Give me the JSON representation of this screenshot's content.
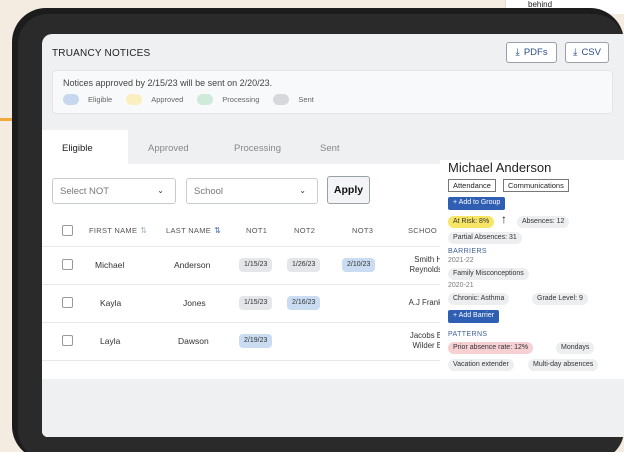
{
  "page": {
    "title": "TRUANCY NOTICES",
    "pdf_label": "PDFs",
    "csv_label": "CSV",
    "bg_peek_text": "behind"
  },
  "notice": {
    "text": "Notices approved by 2/15/23 will be sent on 2/20/23.",
    "legend": [
      {
        "label": "Eligible",
        "color": "#c7d8ee"
      },
      {
        "label": "Approved",
        "color": "#fbeec0"
      },
      {
        "label": "Processing",
        "color": "#cfe9da"
      },
      {
        "label": "Sent",
        "color": "#d6d8db"
      }
    ]
  },
  "tabs": [
    {
      "label": "Eligible",
      "active": true
    },
    {
      "label": "Approved",
      "active": false
    },
    {
      "label": "Processing",
      "active": false
    },
    {
      "label": "Sent",
      "active": false
    }
  ],
  "filters": {
    "not_placeholder": "Select NOT",
    "school_placeholder": "School",
    "apply_label": "Apply"
  },
  "table": {
    "headers": {
      "first_name": "FIRST NAME",
      "last_name": "LAST NAME",
      "not1": "NOT1",
      "not2": "NOT2",
      "not3": "NOT3",
      "school": "SCHOO"
    },
    "rows": [
      {
        "first": "Michael",
        "last": "Anderson",
        "not1": "1/15/23",
        "not2": "1/26/23",
        "not3": "2/10/23",
        "school1": "Smith H",
        "school2": "Reynolds"
      },
      {
        "first": "Kayla",
        "last": "Jones",
        "not1": "1/15/23",
        "not2": "2/16/23",
        "not3": "",
        "school1": "A.J Frank",
        "school2": ""
      },
      {
        "first": "Layla",
        "last": "Dawson",
        "not1": "2/19/23",
        "not2": "",
        "not3": "",
        "school1": "Jacobs E",
        "school2": "Wilder E"
      }
    ]
  },
  "panel": {
    "name": "Michael Anderson",
    "tab_attendance": "Attendance",
    "tab_communications": "Communications",
    "add_group": "+ Add to Group",
    "risk": "At Risk: 8%",
    "absences": "Absences: 12",
    "partial": "Partial Absences: 31",
    "barriers_heading": "BARRIERS",
    "year1": "2021-22",
    "barrier1": "Family Misconceptions",
    "year2": "2020-21",
    "barrier2": "Chronic: Asthma",
    "grade": "Grade Level: 9",
    "add_barrier": "+ Add Barrier",
    "patterns_heading": "PATTERNS",
    "pattern1": "Prior absence rate: 12%",
    "pattern2": "Mondays",
    "pattern3": "Vacation extender",
    "pattern4": "Multi-day absences"
  }
}
